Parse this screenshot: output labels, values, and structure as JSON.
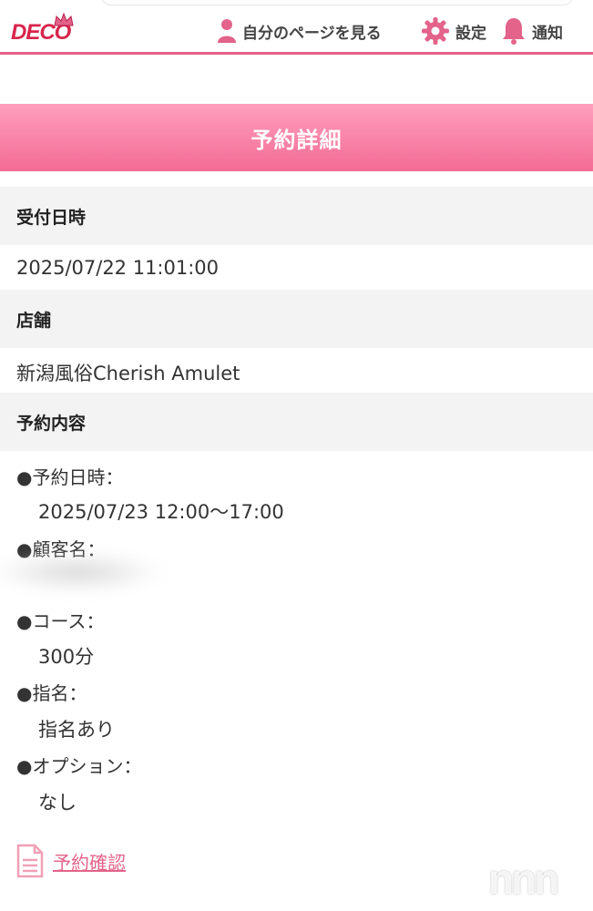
{
  "header": {
    "logo_text": "DECO",
    "nav": [
      {
        "label": "自分のページを見る",
        "icon": "person-icon"
      },
      {
        "label": "設定",
        "icon": "gear-icon"
      },
      {
        "label": "通知",
        "icon": "bell-icon"
      }
    ],
    "accent_color": "#e3638a"
  },
  "page_title": "予約詳細",
  "sections": {
    "received": {
      "heading": "受付日時",
      "value": "2025/07/22 11:01:00"
    },
    "store": {
      "heading": "店舗",
      "value": "新潟風俗Cherish Amulet"
    },
    "content": {
      "heading": "予約内容",
      "items": [
        {
          "label": "●予約日時：",
          "value": "2025/07/23 12:00〜17:00"
        },
        {
          "label": "●顧客名：",
          "value": ""
        },
        {
          "label": "●コース：",
          "value": "300分"
        },
        {
          "label": "●指名：",
          "value": "指名あり"
        },
        {
          "label": "●オプション：",
          "value": "なし"
        }
      ]
    }
  },
  "confirm_link": {
    "label": "予約確認",
    "icon": "document-icon"
  },
  "watermark": "nnn"
}
